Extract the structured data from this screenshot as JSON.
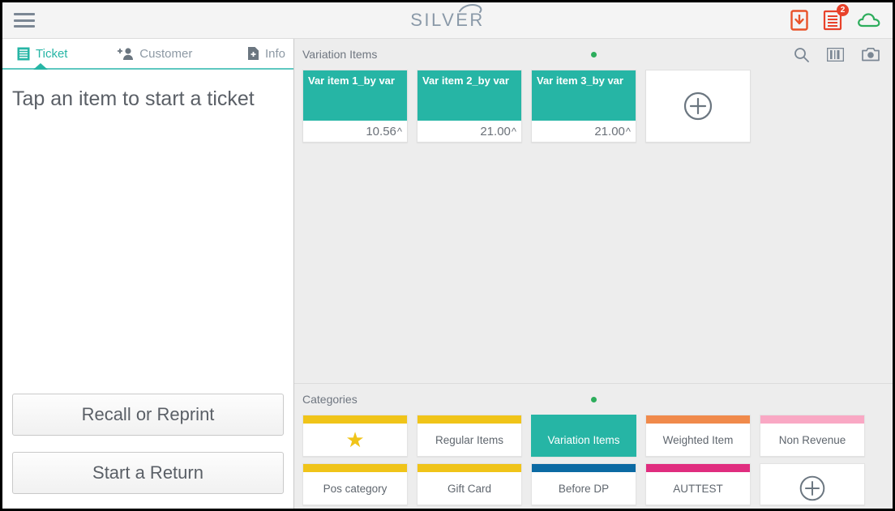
{
  "header": {
    "menu_icon": "hamburger-menu-icon",
    "logo_text": "SILVER",
    "icons": [
      {
        "name": "offline-download-icon",
        "color": "#e8532a",
        "badge": ""
      },
      {
        "name": "open-tickets-receipt-icon",
        "color": "#e8412a",
        "badge": "2"
      },
      {
        "name": "cloud-sync-icon",
        "color": "#2dad5c",
        "badge": ""
      }
    ]
  },
  "left_panel": {
    "tabs": [
      {
        "label": "Ticket",
        "icon": "ticket-receipt-icon",
        "active": true
      },
      {
        "label": "Customer",
        "icon": "add-customer-icon",
        "active": false
      },
      {
        "label": "Info",
        "icon": "info-document-add-icon",
        "active": false
      }
    ],
    "empty_message": "Tap an item to start a ticket",
    "buttons": [
      {
        "label": "Recall or Reprint",
        "name": "recall-or-reprint-button"
      },
      {
        "label": "Start a Return",
        "name": "start-a-return-button"
      }
    ]
  },
  "items_section": {
    "title": "Variation Items",
    "page_indicator_dots": 1,
    "tools": [
      {
        "name": "search-icon"
      },
      {
        "name": "barcode-icon"
      },
      {
        "name": "camera-icon"
      }
    ],
    "items": [
      {
        "name": "Var item 1_by var",
        "price": "10.56",
        "caret": "^",
        "color": "#26b5a5"
      },
      {
        "name": "Var item 2_by var",
        "price": "21.00",
        "caret": "^",
        "color": "#26b5a5"
      },
      {
        "name": "Var item 3_by var",
        "price": "21.00",
        "caret": "^",
        "color": "#26b5a5"
      }
    ],
    "add_tile": {
      "name": "add-item-tile",
      "icon": "plus-circle-icon"
    }
  },
  "categories_section": {
    "title": "Categories",
    "page_indicator_dots": 1,
    "rows": [
      [
        {
          "label": "",
          "icon": "star-icon",
          "bar_color": "#f0c419",
          "selected": false,
          "is_star": true
        },
        {
          "label": "Regular Items",
          "bar_color": "#f0c419",
          "selected": false
        },
        {
          "label": "Variation Items",
          "bar_color": "#26b5a5",
          "selected": true
        },
        {
          "label": "Weighted Item",
          "bar_color": "#f08a4b",
          "selected": false
        },
        {
          "label": "Non Revenue",
          "bar_color": "#f9a8c4",
          "selected": false
        }
      ],
      [
        {
          "label": "Pos category",
          "bar_color": "#f0c419",
          "selected": false
        },
        {
          "label": "Gift Card",
          "bar_color": "#f0c419",
          "selected": false
        },
        {
          "label": "Before DP",
          "bar_color": "#0b6aa3",
          "selected": false
        },
        {
          "label": "AUTTEST",
          "bar_color": "#e02d7f",
          "selected": false
        },
        {
          "label": "",
          "icon": "plus-circle-icon",
          "bar_color": "transparent",
          "selected": false,
          "is_add": true
        }
      ]
    ]
  },
  "colors": {
    "teal": "#26b5a5",
    "yellow": "#f0c419",
    "orange": "#f08a4b",
    "pink": "#f9a8c4",
    "magenta": "#e02d7f",
    "blue": "#0b6aa3",
    "green_dot": "#2dad5c",
    "panel_bg": "#ededed"
  }
}
